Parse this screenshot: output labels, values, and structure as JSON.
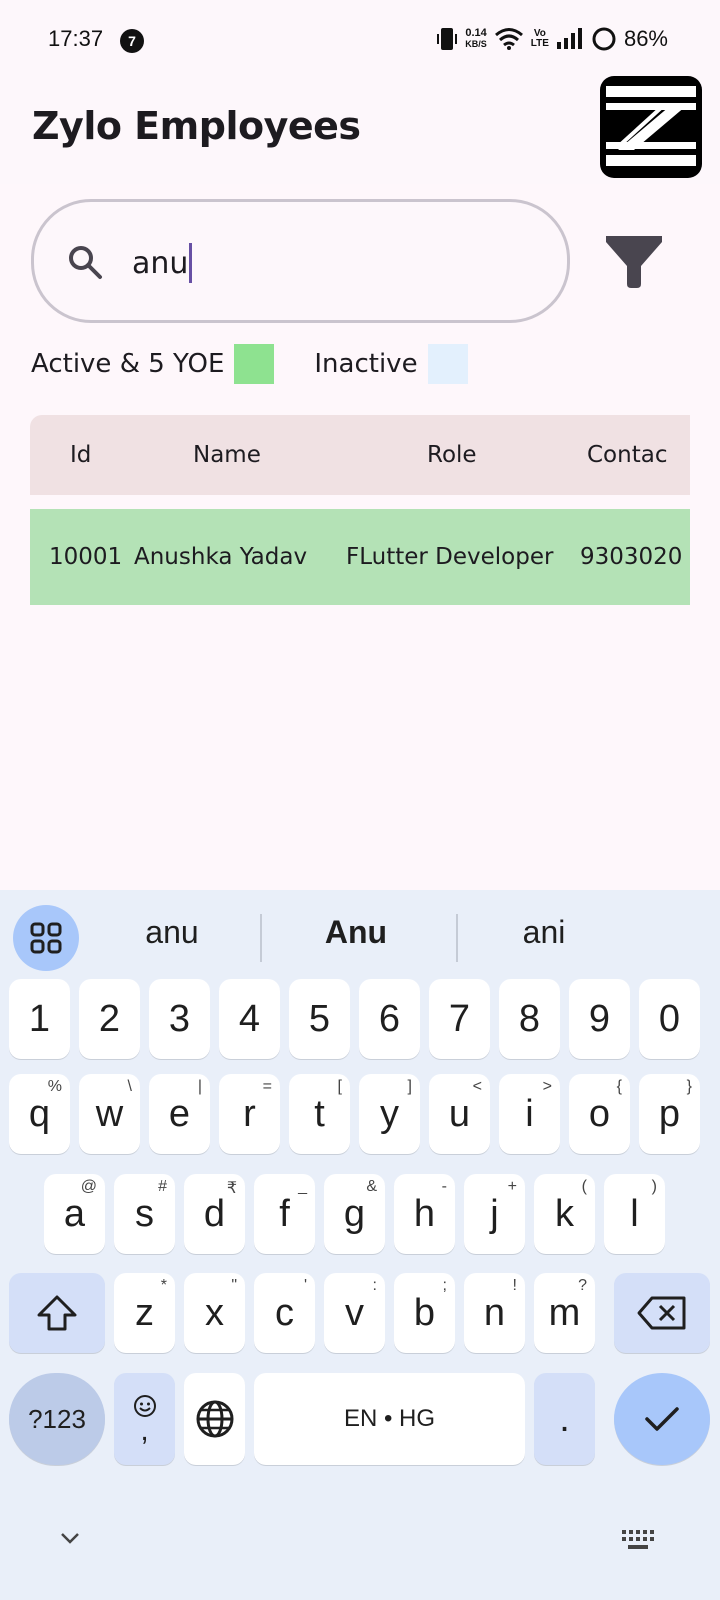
{
  "status_bar": {
    "time": "17:37",
    "notification_count": "7",
    "network_speed_value": "0.14",
    "network_speed_unit": "KB/S",
    "volte_top": "Vo",
    "volte_bottom": "LTE",
    "battery_percent": "86%"
  },
  "app_bar": {
    "title": "Zylo Employees",
    "logo_icon": "zylo-z-logo"
  },
  "search": {
    "value": "anu",
    "icon": "search-icon"
  },
  "filter": {
    "icon": "filter-funnel-icon"
  },
  "legend": [
    {
      "label": "Active & 5 YOE",
      "color": "#8ee290"
    },
    {
      "label": "Inactive",
      "color": "#e3f0fd"
    }
  ],
  "table": {
    "columns": [
      "Id",
      "Name",
      "Role",
      "Contac"
    ],
    "rows": [
      {
        "id": "10001",
        "name": "Anushka Yadav",
        "role": "FLutter Developer",
        "contact": "9303020",
        "color": "#b4e2b6"
      }
    ]
  },
  "keyboard": {
    "suggestions": [
      "anu",
      "Anu",
      "ani"
    ],
    "number_row": [
      "1",
      "2",
      "3",
      "4",
      "5",
      "6",
      "7",
      "8",
      "9",
      "0"
    ],
    "row1": [
      {
        "k": "q",
        "h": "%"
      },
      {
        "k": "w",
        "h": "\\"
      },
      {
        "k": "e",
        "h": "|"
      },
      {
        "k": "r",
        "h": "="
      },
      {
        "k": "t",
        "h": "["
      },
      {
        "k": "y",
        "h": "]"
      },
      {
        "k": "u",
        "h": "<"
      },
      {
        "k": "i",
        "h": ">"
      },
      {
        "k": "o",
        "h": "{"
      },
      {
        "k": "p",
        "h": "}"
      }
    ],
    "row2": [
      {
        "k": "a",
        "h": "@"
      },
      {
        "k": "s",
        "h": "#"
      },
      {
        "k": "d",
        "h": "₹"
      },
      {
        "k": "f",
        "h": "_"
      },
      {
        "k": "g",
        "h": "&"
      },
      {
        "k": "h",
        "h": "-"
      },
      {
        "k": "j",
        "h": "+"
      },
      {
        "k": "k",
        "h": "("
      },
      {
        "k": "l",
        "h": ")"
      }
    ],
    "row3": [
      {
        "k": "z",
        "h": "*"
      },
      {
        "k": "x",
        "h": "\""
      },
      {
        "k": "c",
        "h": "'"
      },
      {
        "k": "v",
        "h": ":"
      },
      {
        "k": "b",
        "h": ";"
      },
      {
        "k": "n",
        "h": "!"
      },
      {
        "k": "m",
        "h": "?"
      }
    ],
    "symbols_label": "?123",
    "comma_label": ",",
    "space_label": "EN • HG",
    "period_label": "."
  }
}
